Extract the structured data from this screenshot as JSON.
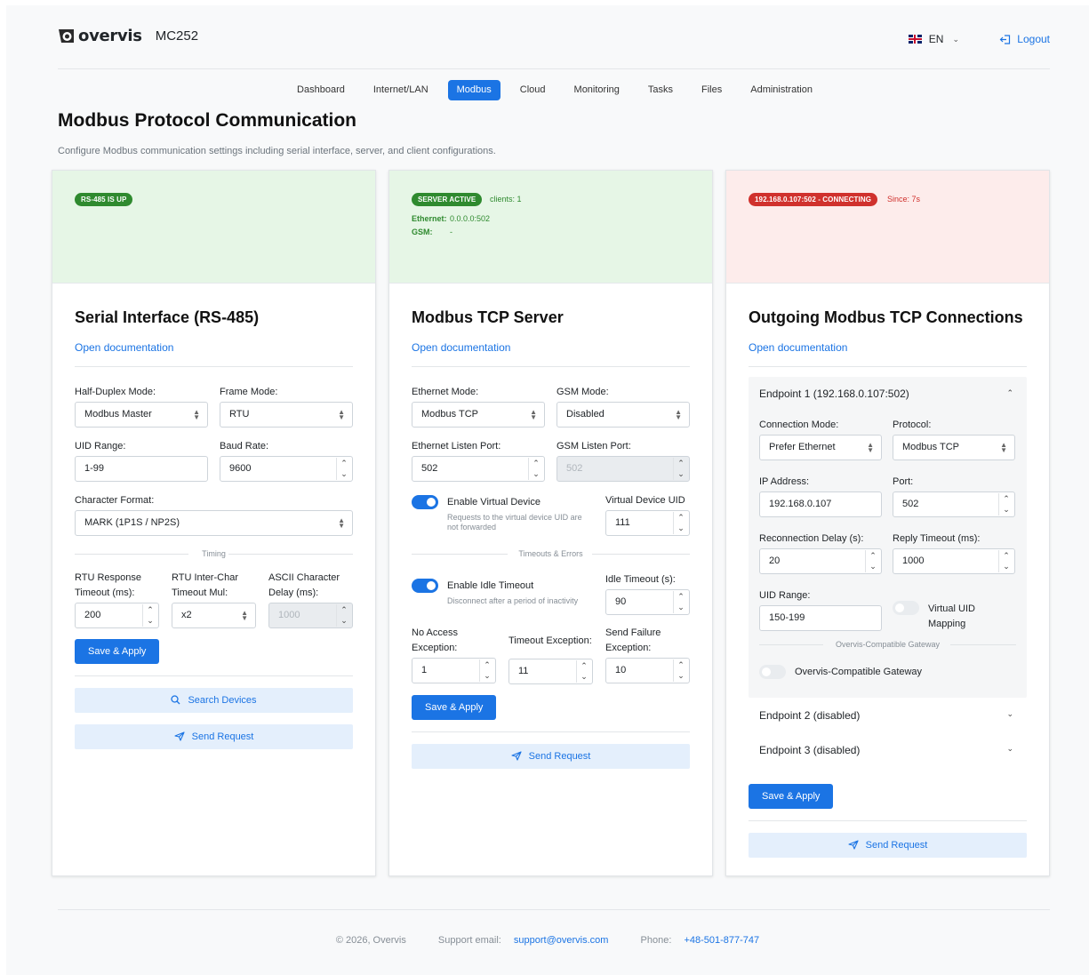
{
  "header": {
    "brand": "overvis",
    "model": "MC252",
    "language": "EN",
    "logout_label": "Logout"
  },
  "nav": {
    "items": [
      "Dashboard",
      "Internet/LAN",
      "Modbus",
      "Cloud",
      "Monitoring",
      "Tasks",
      "Files",
      "Administration"
    ],
    "active": "Modbus"
  },
  "page": {
    "title": "Modbus Protocol Communication",
    "description": "Configure Modbus communication settings including serial interface, server, and client configurations."
  },
  "serial": {
    "status_badge": "RS-485 IS UP",
    "title": "Serial Interface (RS-485)",
    "doc_link": "Open documentation",
    "half_duplex_label": "Half-Duplex Mode:",
    "half_duplex_value": "Modbus Master",
    "frame_mode_label": "Frame Mode:",
    "frame_mode_value": "RTU",
    "uid_range_label": "UID Range:",
    "uid_range_value": "1-99",
    "baud_rate_label": "Baud Rate:",
    "baud_rate_value": "9600",
    "char_format_label": "Character Format:",
    "char_format_value": "MARK (1P1S / NP2S)",
    "timing_label": "Timing",
    "rtu_resp_label_1": "RTU Response",
    "rtu_resp_label_2": "Timeout (ms):",
    "rtu_resp_value": "200",
    "rtu_inter_label_1": "RTU Inter-Char",
    "rtu_inter_label_2": "Timeout Mul:",
    "rtu_inter_value": "x2",
    "ascii_delay_label_1": "ASCII Character",
    "ascii_delay_label_2": "Delay (ms):",
    "ascii_delay_value": "1000",
    "save_label": "Save & Apply",
    "search_label": "Search Devices",
    "send_label": "Send Request"
  },
  "tcp_server": {
    "status_badge": "SERVER ACTIVE",
    "clients": "clients: 1",
    "ethernet_label": "Ethernet:",
    "ethernet_value": "0.0.0.0:502",
    "gsm_label": "GSM:",
    "gsm_value": "-",
    "title": "Modbus TCP Server",
    "doc_link": "Open documentation",
    "eth_mode_label": "Ethernet Mode:",
    "eth_mode_value": "Modbus TCP",
    "gsm_mode_label": "GSM Mode:",
    "gsm_mode_value": "Disabled",
    "eth_port_label": "Ethernet Listen Port:",
    "eth_port_value": "502",
    "gsm_port_label": "GSM Listen Port:",
    "gsm_port_value": "502",
    "virtual_device_label": "Enable Virtual Device",
    "virtual_device_sub_1": "Requests to the virtual device UID are",
    "virtual_device_sub_2": "not forwarded",
    "virtual_uid_label": "Virtual Device UID",
    "virtual_uid_value": "111",
    "timeouts_label": "Timeouts & Errors",
    "idle_timeout_label": "Enable Idle Timeout",
    "idle_timeout_sub": "Disconnect after a period of inactivity",
    "idle_seconds_label": "Idle Timeout (s):",
    "idle_seconds_value": "90",
    "no_access_label_1": "No Access",
    "no_access_label_2": "Exception:",
    "no_access_value": "1",
    "timeout_exc_label": "Timeout Exception:",
    "timeout_exc_value": "11",
    "send_fail_label_1": "Send Failure",
    "send_fail_label_2": "Exception:",
    "send_fail_value": "10",
    "save_label": "Save & Apply",
    "send_label": "Send Request"
  },
  "outgoing": {
    "status_badge": "192.168.0.107:502 - CONNECTING",
    "since": "Since: 7s",
    "title": "Outgoing Modbus TCP Connections",
    "doc_link": "Open documentation",
    "endpoint1_title": "Endpoint 1 (192.168.0.107:502)",
    "conn_mode_label": "Connection Mode:",
    "conn_mode_value": "Prefer Ethernet",
    "protocol_label": "Protocol:",
    "protocol_value": "Modbus TCP",
    "ip_label": "IP Address:",
    "ip_value": "192.168.0.107",
    "port_label": "Port:",
    "port_value": "502",
    "reconnect_label": "Reconnection Delay (s):",
    "reconnect_value": "20",
    "reply_timeout_label": "Reply Timeout (ms):",
    "reply_timeout_value": "1000",
    "uid_range_label": "UID Range:",
    "uid_range_value": "150-199",
    "virtual_uid_label_1": "Virtual UID",
    "virtual_uid_label_2": "Mapping",
    "gateway_sep": "Overvis-Compatible Gateway",
    "gateway_label": "Overvis-Compatible Gateway",
    "endpoint2_title": "Endpoint 2 (disabled)",
    "endpoint3_title": "Endpoint 3 (disabled)",
    "save_label": "Save & Apply",
    "send_label": "Send Request"
  },
  "footer": {
    "copyright": "© 2026, Overvis",
    "support_label": "Support email:",
    "support_email": "support@overvis.com",
    "phone_label": "Phone:",
    "phone": "+48-501-877-747"
  },
  "colors": {
    "accent": "#1b74e4",
    "status_ok": "#2f8a2f",
    "status_error": "#d0312d"
  },
  "icons": [
    "overvis-logo-icon",
    "uk-flag-icon",
    "chevron-down-icon",
    "logout-icon",
    "search-icon",
    "send-icon",
    "chevron-up-icon"
  ]
}
